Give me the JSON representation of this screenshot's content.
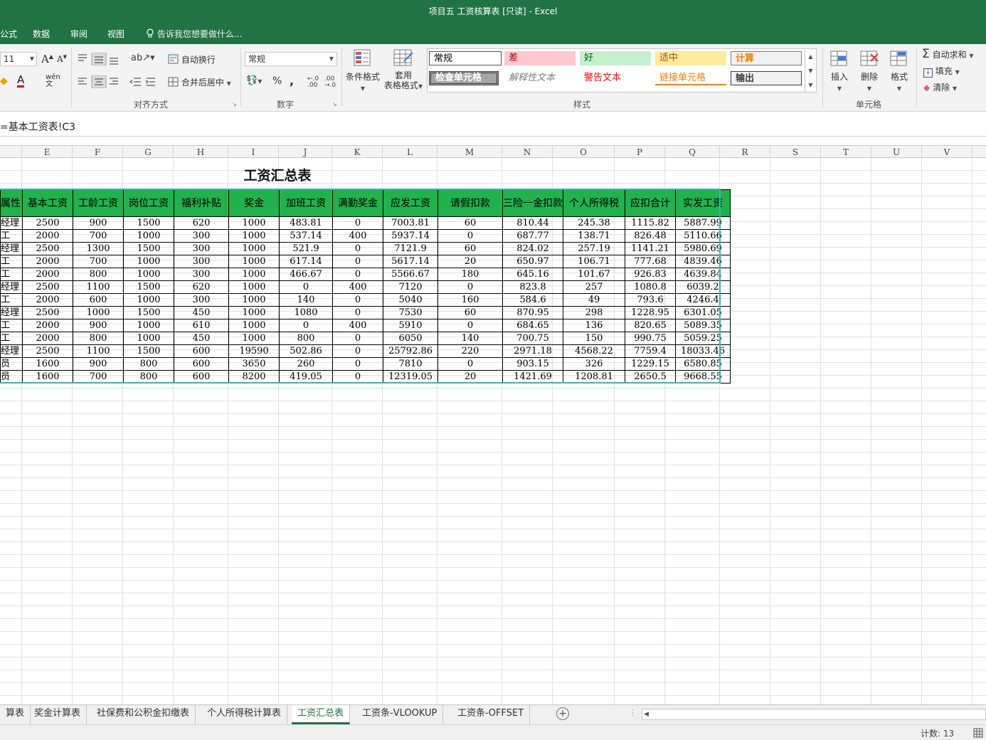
{
  "window": {
    "title": "项目五 工资核算表 [只读] - Excel"
  },
  "menu": {
    "items": [
      "公式",
      "数据",
      "审阅",
      "视图"
    ],
    "tell_me": "告诉我您想要做什么..."
  },
  "ribbon": {
    "font_size": "11",
    "font_inc": "A",
    "font_dec": "A",
    "wen": "wén",
    "wrap_text": "自动换行",
    "merge_center": "合并后居中",
    "align_group": "对齐方式",
    "number_format": "常规",
    "percent": "%",
    "comma": ",",
    "number_group": "数字",
    "cond_format": "条件格式",
    "table_format_1": "套用",
    "table_format_2": "表格格式",
    "styles": {
      "normal": "常规",
      "bad": "差",
      "good": "好",
      "neutral": "适中",
      "calc": "计算",
      "check": "检查单元格",
      "explanatory": "解释性文本",
      "warning": "警告文本",
      "linked": "链接单元格",
      "output": "输出"
    },
    "styles_group": "样式",
    "insert": "插入",
    "delete": "删除",
    "format": "格式",
    "cells_group": "单元格",
    "autosum": "自动求和",
    "fill": "填充",
    "clear": "清除",
    "sigma": "Σ"
  },
  "formula": {
    "text": "=基本工资表!C3"
  },
  "columns": [
    "E",
    "F",
    "G",
    "H",
    "I",
    "J",
    "K",
    "L",
    "M",
    "N",
    "O",
    "P",
    "Q",
    "R",
    "S",
    "T",
    "U",
    "V"
  ],
  "sheet": {
    "title": "工资汇总表",
    "headers": [
      "属性",
      "基本工资",
      "工龄工资",
      "岗位工资",
      "福利补贴",
      "奖金",
      "加班工资",
      "满勤奖金",
      "应发工资",
      "请假扣款",
      "三险一金扣款",
      "个人所得税",
      "应扣合计",
      "实发工资"
    ],
    "rows": [
      [
        "经理",
        "2500",
        "900",
        "1500",
        "620",
        "1000",
        "483.81",
        "0",
        "7003.81",
        "60",
        "810.44",
        "245.38",
        "1115.82",
        "5887.99"
      ],
      [
        "工",
        "2000",
        "700",
        "1000",
        "300",
        "1000",
        "537.14",
        "400",
        "5937.14",
        "0",
        "687.77",
        "138.71",
        "826.48",
        "5110.66"
      ],
      [
        "经理",
        "2500",
        "1300",
        "1500",
        "300",
        "1000",
        "521.9",
        "0",
        "7121.9",
        "60",
        "824.02",
        "257.19",
        "1141.21",
        "5980.69"
      ],
      [
        "工",
        "2000",
        "700",
        "1000",
        "300",
        "1000",
        "617.14",
        "0",
        "5617.14",
        "20",
        "650.97",
        "106.71",
        "777.68",
        "4839.46"
      ],
      [
        "工",
        "2000",
        "800",
        "1000",
        "300",
        "1000",
        "466.67",
        "0",
        "5566.67",
        "180",
        "645.16",
        "101.67",
        "926.83",
        "4639.84"
      ],
      [
        "经理",
        "2500",
        "1100",
        "1500",
        "620",
        "1000",
        "0",
        "400",
        "7120",
        "0",
        "823.8",
        "257",
        "1080.8",
        "6039.2"
      ],
      [
        "工",
        "2000",
        "600",
        "1000",
        "300",
        "1000",
        "140",
        "0",
        "5040",
        "160",
        "584.6",
        "49",
        "793.6",
        "4246.4"
      ],
      [
        "经理",
        "2500",
        "1000",
        "1500",
        "450",
        "1000",
        "1080",
        "0",
        "7530",
        "60",
        "870.95",
        "298",
        "1228.95",
        "6301.05"
      ],
      [
        "工",
        "2000",
        "900",
        "1000",
        "610",
        "1000",
        "0",
        "400",
        "5910",
        "0",
        "684.65",
        "136",
        "820.65",
        "5089.35"
      ],
      [
        "工",
        "2000",
        "800",
        "1000",
        "450",
        "1000",
        "800",
        "0",
        "6050",
        "140",
        "700.75",
        "150",
        "990.75",
        "5059.25"
      ],
      [
        "经理",
        "2500",
        "1100",
        "1500",
        "600",
        "19590",
        "502.86",
        "0",
        "25792.86",
        "220",
        "2971.18",
        "4568.22",
        "7759.4",
        "18033.46"
      ],
      [
        "员",
        "1600",
        "900",
        "800",
        "600",
        "3650",
        "260",
        "0",
        "7810",
        "0",
        "903.15",
        "326",
        "1229.15",
        "6580.85"
      ],
      [
        "员",
        "1600",
        "700",
        "800",
        "600",
        "8200",
        "419.05",
        "0",
        "12319.05",
        "20",
        "1421.69",
        "1208.81",
        "2650.5",
        "9668.55"
      ]
    ]
  },
  "tabs": [
    "算表",
    "奖金计算表",
    "社保费和公积金扣缴表",
    "个人所得税计算表",
    "工资汇总表",
    "工资条-VLOOKUP",
    "工资条-OFFSET"
  ],
  "active_tab": "工资汇总表",
  "status": {
    "count": "计数: 13"
  },
  "colors": {
    "excel_green": "#217346",
    "header_fill": "#22b14c",
    "selection": "#3bb6b0"
  }
}
